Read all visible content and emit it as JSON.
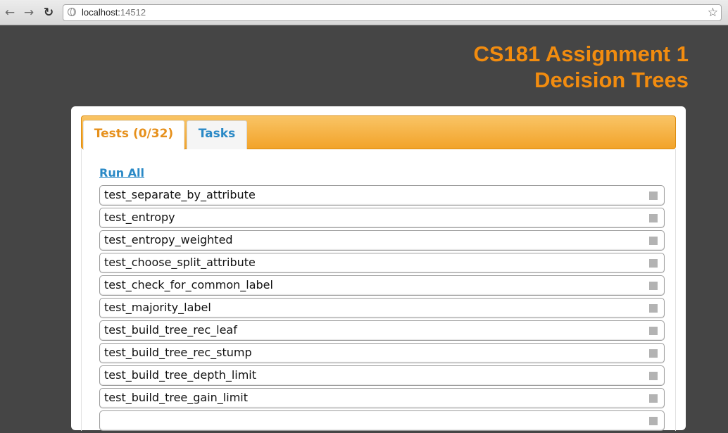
{
  "browser": {
    "url_host": "localhost:",
    "url_port": "14512",
    "back_glyph": "←",
    "forward_glyph": "→",
    "reload_glyph": "C",
    "star_glyph": "☆"
  },
  "header": {
    "title_line1": "CS181 Assignment 1",
    "title_line2": "Decision Trees",
    "accent_color": "#f28c0f"
  },
  "tabs": {
    "tests_label": "Tests (0/32)",
    "tasks_label": "Tasks",
    "active": "tests"
  },
  "run_all_label": "Run All",
  "tests": [
    {
      "name": "test_separate_by_attribute",
      "status": "not-run"
    },
    {
      "name": "test_entropy",
      "status": "not-run"
    },
    {
      "name": "test_entropy_weighted",
      "status": "not-run"
    },
    {
      "name": "test_choose_split_attribute",
      "status": "not-run"
    },
    {
      "name": "test_check_for_common_label",
      "status": "not-run"
    },
    {
      "name": "test_majority_label",
      "status": "not-run"
    },
    {
      "name": "test_build_tree_rec_leaf",
      "status": "not-run"
    },
    {
      "name": "test_build_tree_rec_stump",
      "status": "not-run"
    },
    {
      "name": "test_build_tree_depth_limit",
      "status": "not-run"
    },
    {
      "name": "test_build_tree_gain_limit",
      "status": "not-run"
    },
    {
      "name": "",
      "status": "not-run"
    }
  ]
}
